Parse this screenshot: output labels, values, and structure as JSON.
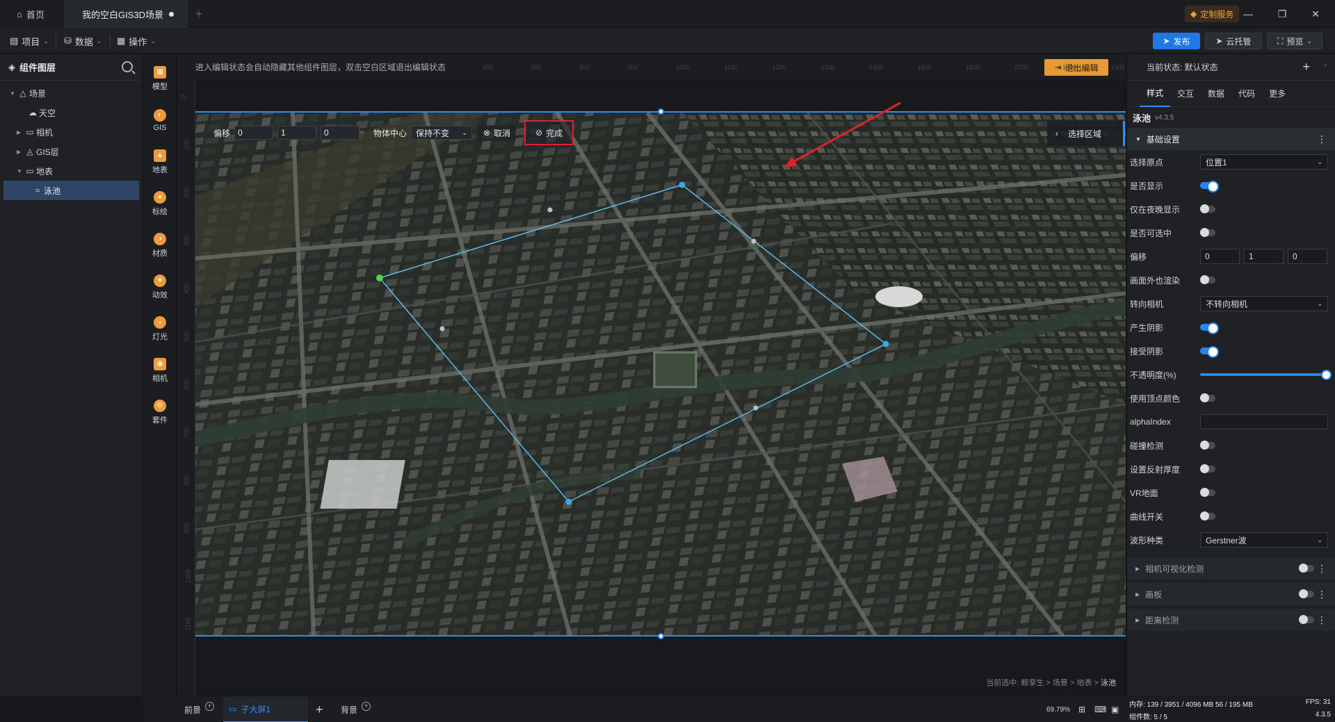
{
  "titlebar": {
    "home_tab": "首页",
    "scene_tab": "我的空白GIS3D场景",
    "custom_service": "定制服务"
  },
  "toolbar": {
    "menu_project": "项目",
    "menu_data": "数据",
    "menu_operate": "操作",
    "publish": "发布",
    "cloud_host": "云托管",
    "preview": "预览"
  },
  "layers": {
    "title": "组件图层",
    "items": [
      {
        "label": "场景",
        "indent": 0,
        "expanded": true,
        "icon": "scene-icon"
      },
      {
        "label": "天空",
        "indent": 1,
        "icon": "sky-icon"
      },
      {
        "label": "相机",
        "indent": 1,
        "collapsed": true,
        "icon": "folder-icon"
      },
      {
        "label": "GIS层",
        "indent": 1,
        "collapsed": true,
        "icon": "gis-layer-icon"
      },
      {
        "label": "地表",
        "indent": 1,
        "expanded": true,
        "icon": "folder-icon"
      },
      {
        "label": "泳池",
        "indent": 2,
        "selected": true,
        "icon": "water-icon"
      }
    ]
  },
  "tools": [
    "模型",
    "GIS",
    "地表",
    "标绘",
    "材质",
    "动效",
    "灯光",
    "相机",
    "套件"
  ],
  "canvas": {
    "hint": "进入编辑状态会自动隐藏其他组件图层，双击空白区域退出编辑状态",
    "exit_edit": "退出编辑",
    "ruler_top": [
      "600",
      "700",
      "800",
      "900",
      "1000",
      "1100",
      "1200",
      "1300",
      "1400",
      "1500",
      "1600",
      "1700",
      "1800",
      "1900"
    ],
    "ruler_left": [
      "0",
      "100",
      "200",
      "300",
      "400",
      "500",
      "600",
      "700",
      "800",
      "900",
      "1000",
      "1100"
    ],
    "edit_bar": {
      "offset_label": "偏移",
      "offset_x": "0",
      "offset_y": "1",
      "offset_z": "0",
      "center_label": "物体中心",
      "center_value": "保持不变",
      "cancel": "取消",
      "done": "完成"
    },
    "select_region": "选择区域",
    "breadcrumb_prefix": "当前选中: 鲸孪生 > 场景 > 地表 > ",
    "breadcrumb_current": "泳池"
  },
  "props": {
    "state_label": "当前状态: 默认状态",
    "tabs": [
      "样式",
      "交互",
      "数据",
      "代码",
      "更多"
    ],
    "active_tab": "样式",
    "component_name": "泳池",
    "component_version": "v4.3.5",
    "basic_section": "基础设置",
    "rows": {
      "origin_label": "选择原点",
      "origin_value": "位置1",
      "visible_label": "是否显示",
      "night_label": "仅在夜晚显示",
      "selectable_label": "是否可选中",
      "offset_label": "偏移",
      "offset_x": "0",
      "offset_y": "1",
      "offset_z": "0",
      "offscreen_label": "画面外也渲染",
      "face_camera_label": "转向相机",
      "face_camera_value": "不转向相机",
      "cast_shadow_label": "产生阴影",
      "receive_shadow_label": "接受阴影",
      "opacity_label": "不透明度(%)",
      "opacity_value": 100,
      "vertex_color_label": "使用顶点颜色",
      "alpha_index_label": "alphaIndex",
      "collision_label": "碰撞检测",
      "reflect_label": "设置反射厚度",
      "vr_label": "VR地面",
      "curve_label": "曲线开关",
      "wave_label": "波形种类",
      "wave_value": "Gerstner波"
    },
    "collapsed_sections": [
      "相机可视化检测",
      "画板",
      "距离检测"
    ]
  },
  "bottombar": {
    "foreground": "前景",
    "sub_screen": "子大屏1",
    "background": "背景",
    "zoom": "69.79%"
  },
  "status": {
    "memory": "内存:  139 / 3951 / 4096 MB   56 / 195 MB",
    "fps": "FPS:  31",
    "components": "组件数: 5 / 5",
    "version": "4.3.5"
  },
  "colors": {
    "accent": "#2e8ff0",
    "warning": "#e69a35",
    "highlight_box": "#e0222a"
  }
}
